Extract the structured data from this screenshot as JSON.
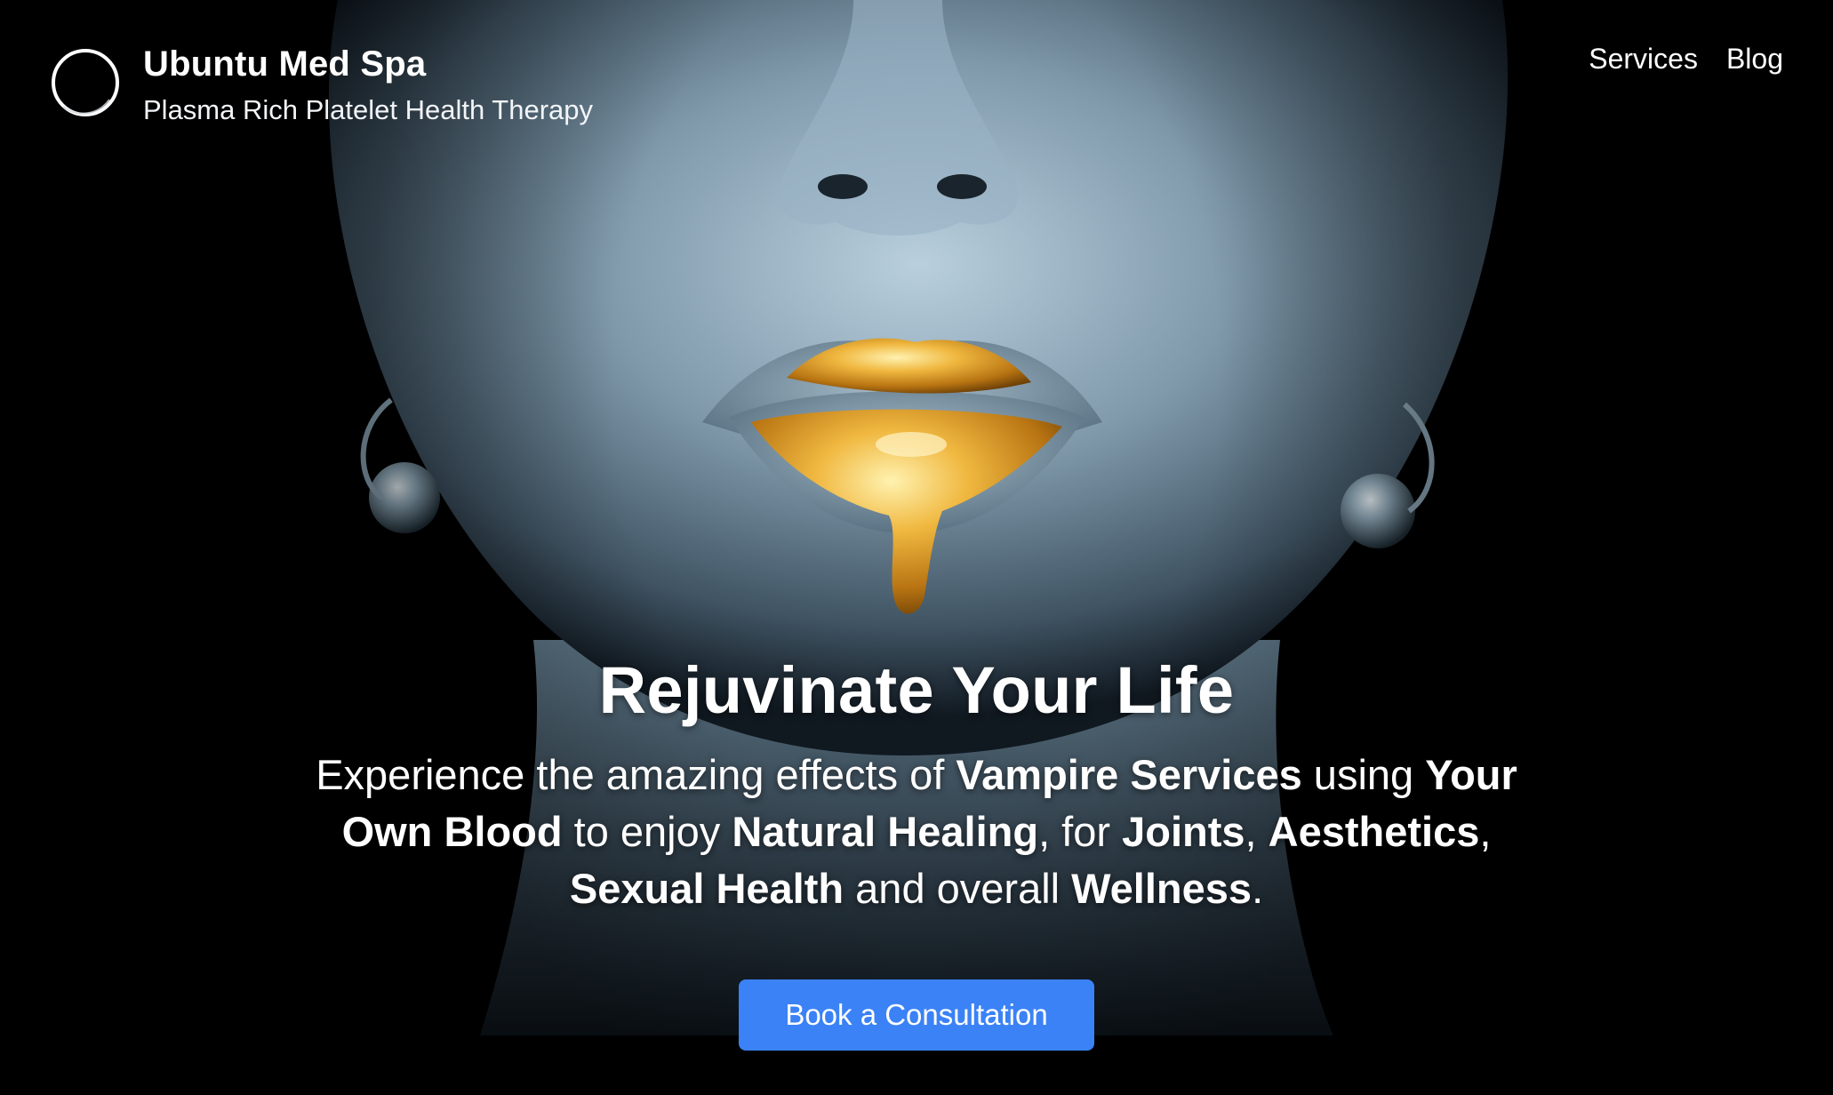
{
  "header": {
    "site_title": "Ubuntu Med Spa",
    "tagline": "Plasma Rich Platelet Health Therapy",
    "logo_icon": "circle-logo-icon",
    "nav": [
      {
        "label": "Services"
      },
      {
        "label": "Blog"
      }
    ]
  },
  "hero": {
    "background_image": "portrait-gold-lips",
    "title": "Rejuvinate Your Life",
    "description": {
      "t1": "Experience the amazing effects of ",
      "b1": "Vampire Services",
      "t2": " using ",
      "b2": "Your Own Blood",
      "t3": " to enjoy ",
      "b3": "Natural Healing",
      "t4": ", for ",
      "b4": "Joints",
      "t5": ", ",
      "b5": "Aesthetics",
      "t6": ", ",
      "b6": "Sexual Health",
      "t7": " and overall ",
      "b7": "Wellness",
      "t8": "."
    },
    "cta_label": "Book a Consultation"
  },
  "colors": {
    "background": "#000000",
    "text": "#ffffff",
    "cta_background": "#3b82f6",
    "skin_tone": "#7f99ab",
    "lip_gold": "#d9a030"
  }
}
